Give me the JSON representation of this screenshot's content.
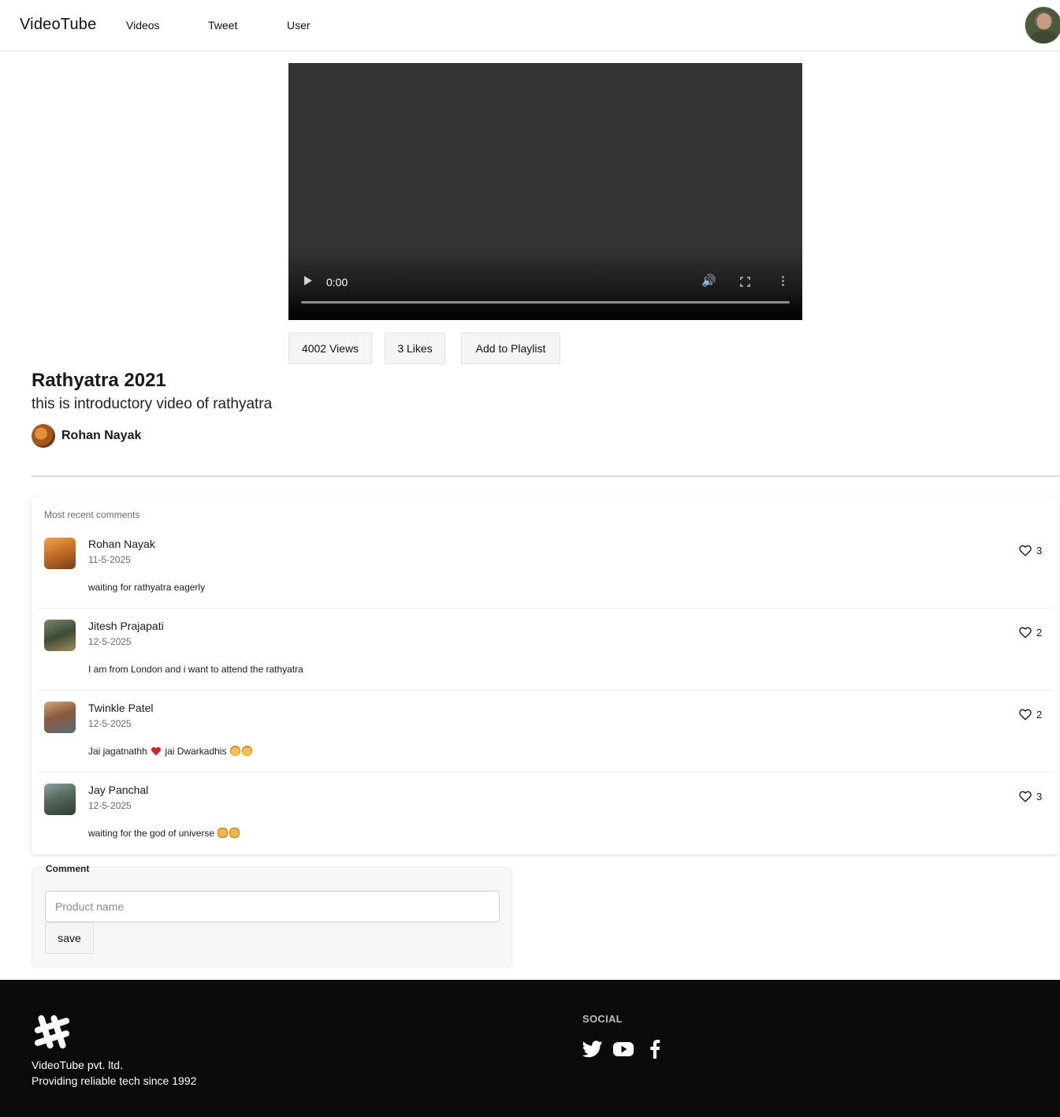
{
  "nav": {
    "brand": "VideoTube",
    "links": [
      {
        "label": "Videos"
      },
      {
        "label": "Tweet"
      },
      {
        "label": "User"
      }
    ]
  },
  "player": {
    "time": "0:00",
    "progress": 0
  },
  "stats": {
    "views": "4002 Views",
    "likes": "3 Likes",
    "playlist": "Add to Playlist"
  },
  "video": {
    "title": "Rathyatra 2021",
    "description": "this is introductory video of rathyatra",
    "owner": "Rohan Nayak"
  },
  "comments": {
    "heading": "Most recent comments",
    "items": [
      {
        "name": "Rohan Nayak",
        "date": "11-5-2025",
        "text": "waiting for rathyatra eagerly",
        "likes": "3"
      },
      {
        "name": "Jitesh Prajapati",
        "date": "12-5-2025",
        "text": "I am from London and i want to attend the rathyatra",
        "likes": "2"
      },
      {
        "name": "Twinkle Patel",
        "date": "12-5-2025",
        "text_a": "Jai jagatnathh",
        "text_b": "jai Dwarkadhis",
        "likes": "2"
      },
      {
        "name": "Jay Panchal",
        "date": "12-5-2025",
        "text": "waiting for the god of universe",
        "likes": "3"
      }
    ]
  },
  "form": {
    "label": "Comment",
    "placeholder": "Product name",
    "save_label": "save"
  },
  "footer": {
    "company": "VideoTube pvt. ltd.",
    "tagline": "Providing reliable tech since 1992",
    "social_heading": "SOCIAL",
    "icons": [
      "twitter-icon",
      "youtube-icon",
      "facebook-icon"
    ]
  },
  "colors": {
    "footer_bg": "#0b0b0c",
    "video_bg": "#333333"
  }
}
